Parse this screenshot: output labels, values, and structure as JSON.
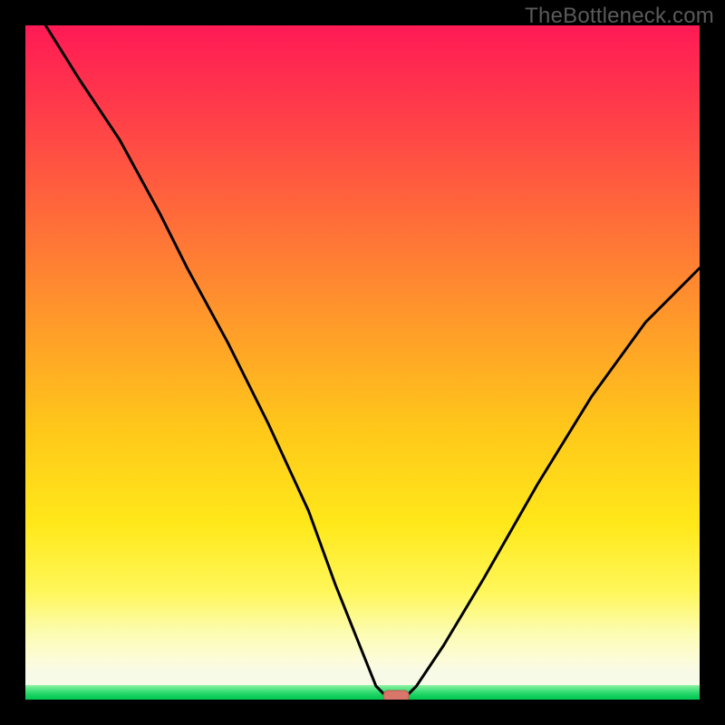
{
  "watermark": "TheBottleneck.com",
  "colors": {
    "frame_bg": "#000000",
    "curve": "#000000",
    "marker_fill": "#d8766a",
    "marker_stroke": "#b85a50",
    "watermark_text": "#5a5a5a"
  },
  "chart_data": {
    "type": "line",
    "title": "",
    "xlabel": "",
    "ylabel": "",
    "xlim": [
      0,
      100
    ],
    "ylim": [
      0,
      100
    ],
    "grid": false,
    "legend_position": "none",
    "annotations": [
      "TheBottleneck.com"
    ],
    "series": [
      {
        "name": "bottleneck-curve",
        "x": [
          3,
          8,
          14,
          20,
          24,
          30,
          36,
          42,
          46,
          50,
          52,
          54,
          55,
          56,
          58,
          62,
          68,
          76,
          84,
          92,
          100
        ],
        "y": [
          100,
          92,
          83,
          72,
          64,
          53,
          41,
          28,
          17,
          7,
          2,
          0,
          0,
          0,
          2,
          8,
          18,
          32,
          45,
          56,
          64
        ]
      }
    ],
    "marker": {
      "x": 55,
      "y": 0,
      "shape": "pill"
    },
    "background_gradient": {
      "type": "vertical",
      "stops": [
        {
          "pos": 0.0,
          "color": "#ff1a55"
        },
        {
          "pos": 0.28,
          "color": "#ff6a3a"
        },
        {
          "pos": 0.6,
          "color": "#ffc81a"
        },
        {
          "pos": 0.9,
          "color": "#fcfcb0"
        },
        {
          "pos": 0.98,
          "color": "#3fe07a"
        },
        {
          "pos": 1.0,
          "color": "#00c850"
        }
      ]
    }
  }
}
